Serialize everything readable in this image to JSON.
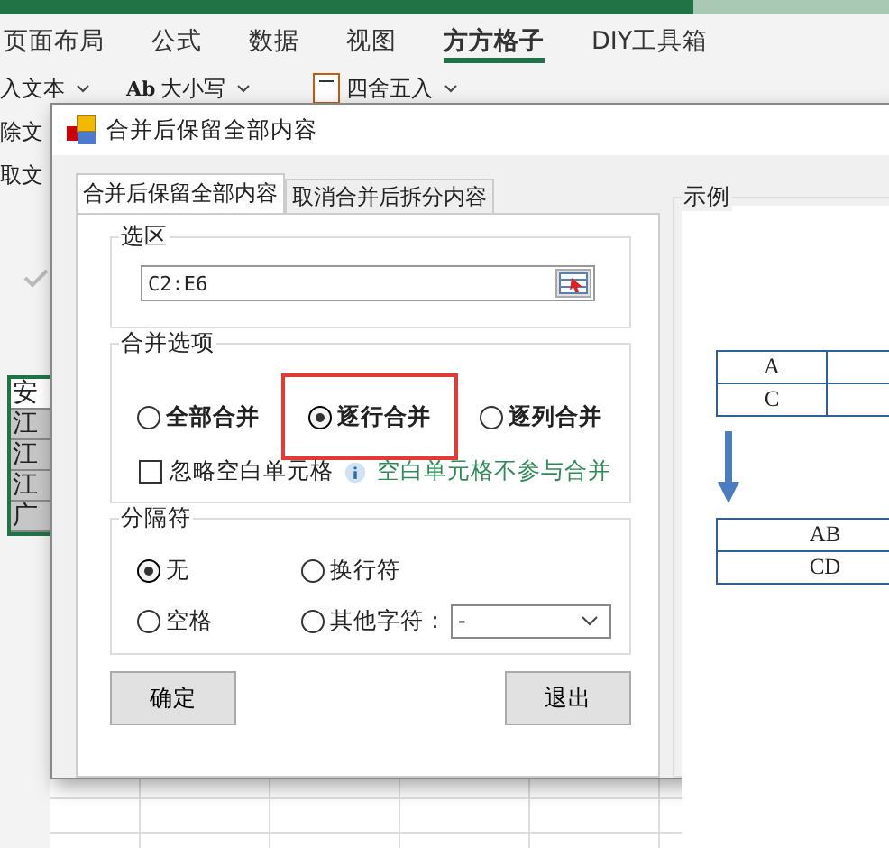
{
  "ribbon": {
    "tabs": [
      {
        "label": "页面布局",
        "selected": false
      },
      {
        "label": "公式",
        "selected": false
      },
      {
        "label": "数据",
        "selected": false
      },
      {
        "label": "视图",
        "selected": false
      },
      {
        "label": "方方格子",
        "selected": true
      },
      {
        "label": "DIY工具箱",
        "selected": false
      }
    ],
    "tools": [
      {
        "label": "入文本"
      },
      {
        "prefix": "Ab",
        "label": "大小写"
      },
      {
        "label": "四舍五入"
      }
    ],
    "side_items": [
      "除文",
      "取文"
    ]
  },
  "sheet": {
    "cells": [
      "安",
      "江",
      "江",
      "江",
      "广"
    ]
  },
  "dialog": {
    "title": "合并后保留全部内容",
    "tabs": [
      {
        "label": "合并后保留全部内容",
        "selected": true
      },
      {
        "label": "取消合并后拆分内容",
        "selected": false
      }
    ],
    "range": {
      "title": "选区",
      "value": "C2:E6"
    },
    "merge": {
      "title": "合并选项",
      "options": [
        {
          "label": "全部合并",
          "selected": false
        },
        {
          "label": "逐行合并",
          "selected": true
        },
        {
          "label": "逐列合并",
          "selected": false
        }
      ],
      "ignore_blank": {
        "label": "忽略空白单元格",
        "checked": false
      },
      "hint": "空白单元格不参与合并"
    },
    "separator": {
      "title": "分隔符",
      "options": [
        {
          "label": "无",
          "selected": true
        },
        {
          "label": "换行符",
          "selected": false
        },
        {
          "label": "空格",
          "selected": false
        },
        {
          "label": "其他字符：",
          "selected": false
        }
      ],
      "other_value": "-"
    },
    "buttons": [
      "确定",
      "退出"
    ],
    "example": {
      "title": "示例",
      "before": [
        [
          "A"
        ],
        [
          "C"
        ]
      ],
      "after": [
        "AB",
        "CD"
      ]
    }
  }
}
